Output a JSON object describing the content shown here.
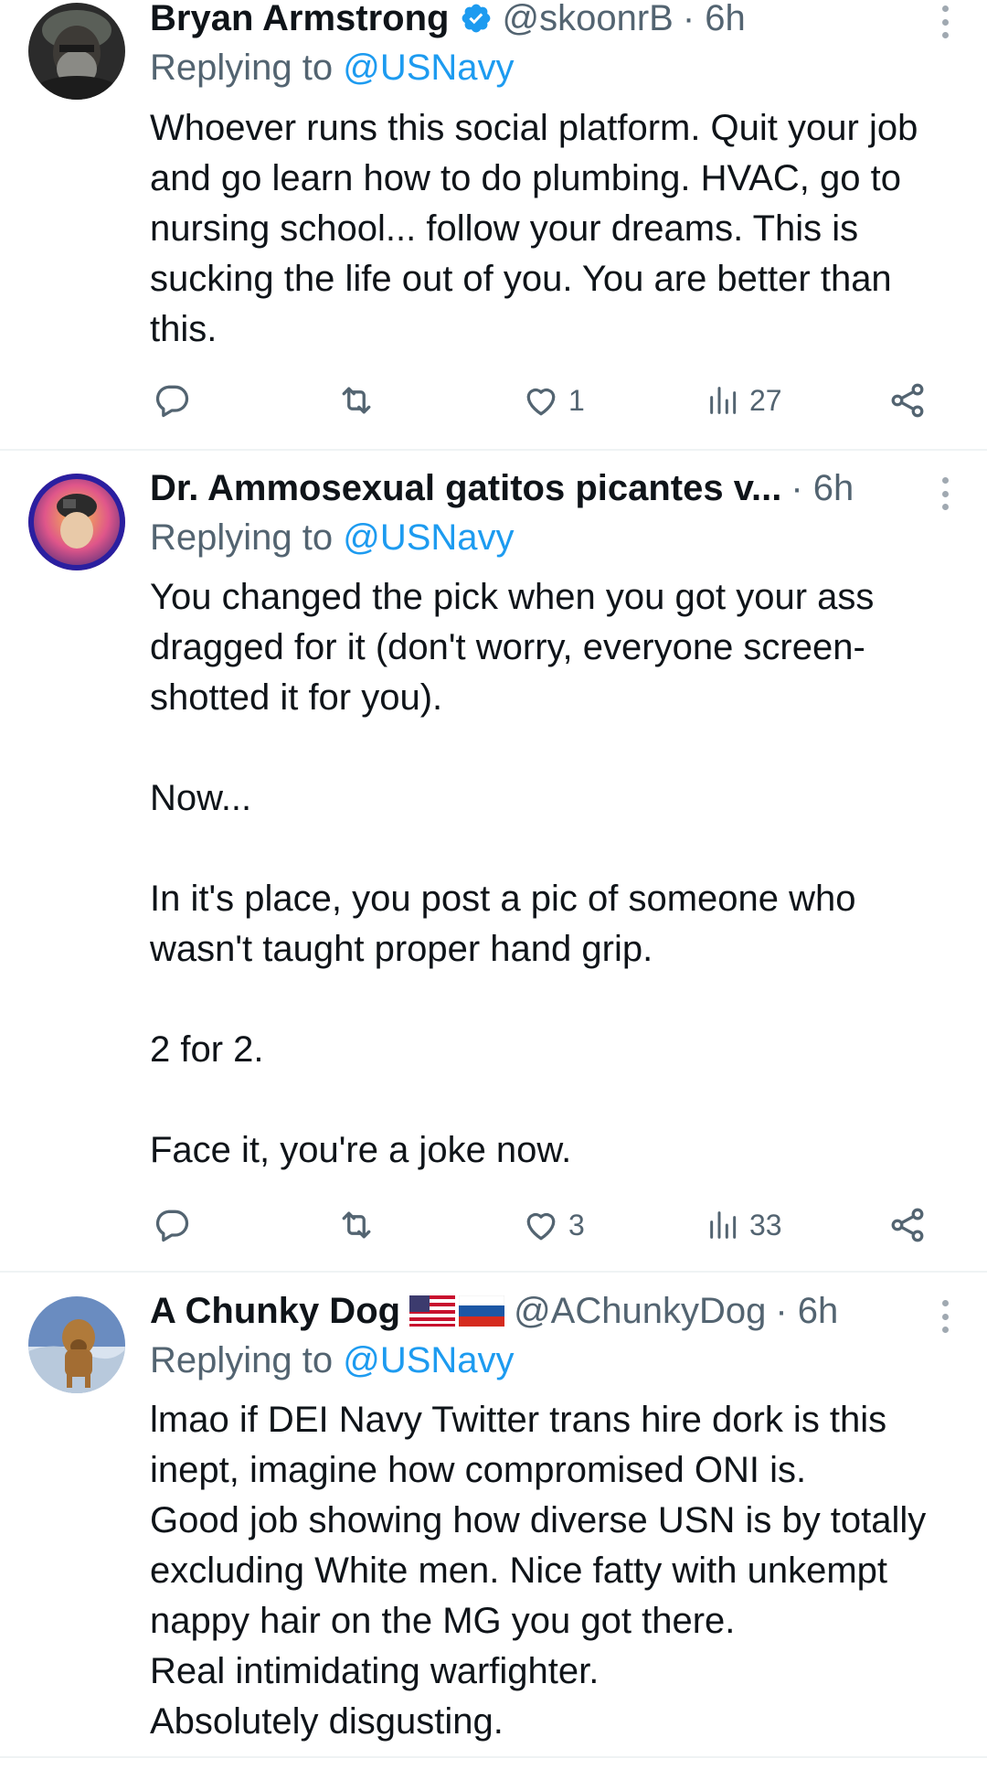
{
  "posts": [
    {
      "name": "Bryan Armstrong",
      "handle": "@skoonrB",
      "time": "· 6h",
      "verified": true,
      "replying_prefix": "Replying to ",
      "replying_to": "@USNavy",
      "paragraphs": [
        "Whoever runs this social platform. Quit your job and go learn how to do plumbing. HVAC, go to nursing school... follow your dreams. This is sucking the life out of you. You are better than this."
      ],
      "likes": "1",
      "views": "27"
    },
    {
      "name": "Dr. Ammosexual gatitos picantes v...",
      "handle": "",
      "time": "· 6h",
      "verified": false,
      "replying_prefix": "Replying to ",
      "replying_to": "@USNavy",
      "paragraphs": [
        "You changed the pick when you got your ass dragged for it (don't worry, everyone screen-shotted it for you).",
        "",
        "Now...",
        "",
        "In it's place, you post a pic of someone who wasn't taught proper hand grip.",
        "",
        "2 for 2.",
        "",
        "Face it, you're a joke now."
      ],
      "likes": "3",
      "views": "33"
    },
    {
      "name": "A Chunky Dog",
      "handle": "@AChunkyDog",
      "time": "· 6h",
      "verified": false,
      "flags": [
        "us-flag",
        "russia-flag"
      ],
      "replying_prefix": "Replying to ",
      "replying_to": "@USNavy",
      "paragraphs": [
        "lmao if DEI Navy Twitter trans hire dork is this inept, imagine how compromised ONI is.",
        "Good job showing how diverse USN is by totally excluding White men. Nice fatty with unkempt nappy hair on the MG you got there.",
        "Real intimidating warfighter.",
        "Absolutely disgusting."
      ]
    }
  ],
  "colors": {
    "text": "#0f1419",
    "secondary": "#536471",
    "link": "#1d9bf0",
    "divider": "#eff3f4"
  },
  "icons": [
    "reply-icon",
    "retweet-icon",
    "like-icon",
    "views-icon",
    "share-icon",
    "more-icon",
    "verified-badge-icon"
  ]
}
